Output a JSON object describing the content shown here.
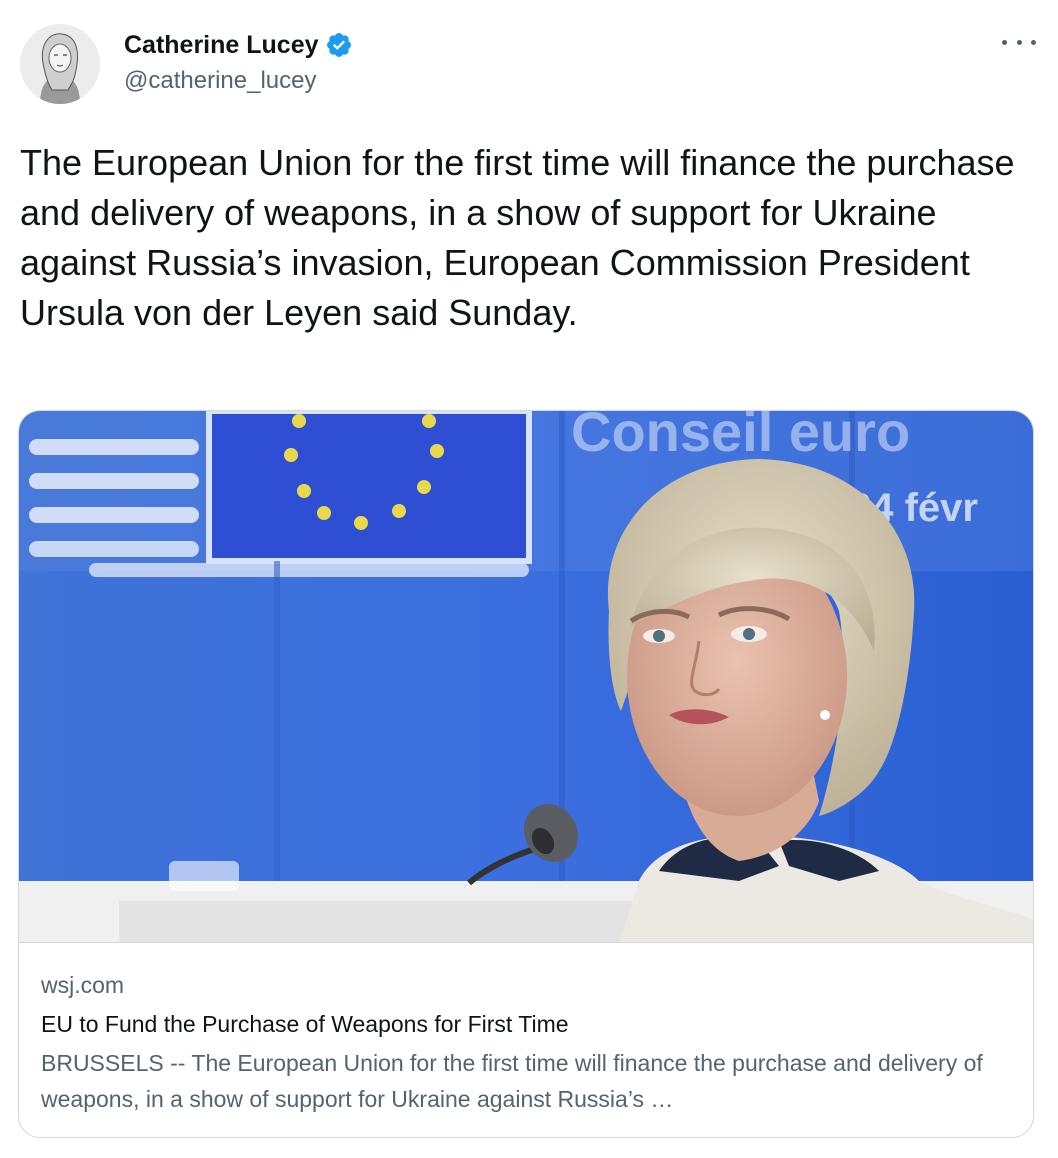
{
  "author": {
    "display_name": "Catherine Lucey",
    "handle": "@catherine_lucey",
    "verified": true
  },
  "tweet": {
    "text": "The European Union for the first time will finance the purchase and delivery of weapons, in a show of support for Ukraine against Russia’s invasion, European Commission President Ursula von der Leyen said Sunday."
  },
  "link_card": {
    "domain": "wsj.com",
    "title": "EU to Fund the Purchase of Weapons for First Time",
    "description": "BRUSSELS -- The European Union for the first time will finance the purchase and delivery of weapons, in a show of support for Ukraine against Russia’s …",
    "image_backdrop_text_1": "Conseil euro",
    "image_backdrop_text_2": "24 févr"
  },
  "icons": {
    "verified": "verified-badge-icon",
    "more": "more-options-icon"
  },
  "colors": {
    "text_primary": "#0f1419",
    "text_secondary": "#536471",
    "verified_blue": "#1d9bf0",
    "border": "#cfd9de",
    "eu_blue": "#2f5fd6"
  }
}
